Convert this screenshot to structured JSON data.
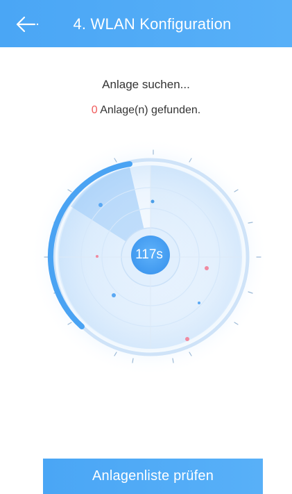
{
  "header": {
    "title": "4. WLAN Konfiguration"
  },
  "status": {
    "searching": "Anlage suchen...",
    "found_count": "0",
    "found_suffix": " Anlage(n) gefunden."
  },
  "radar": {
    "timer": "117s"
  },
  "action": {
    "label": "Anlagenliste prüfen"
  },
  "colors": {
    "primary": "#4aa6f5",
    "count_red": "#f05b5b"
  },
  "icons": {
    "back": "arrow-left-icon"
  }
}
